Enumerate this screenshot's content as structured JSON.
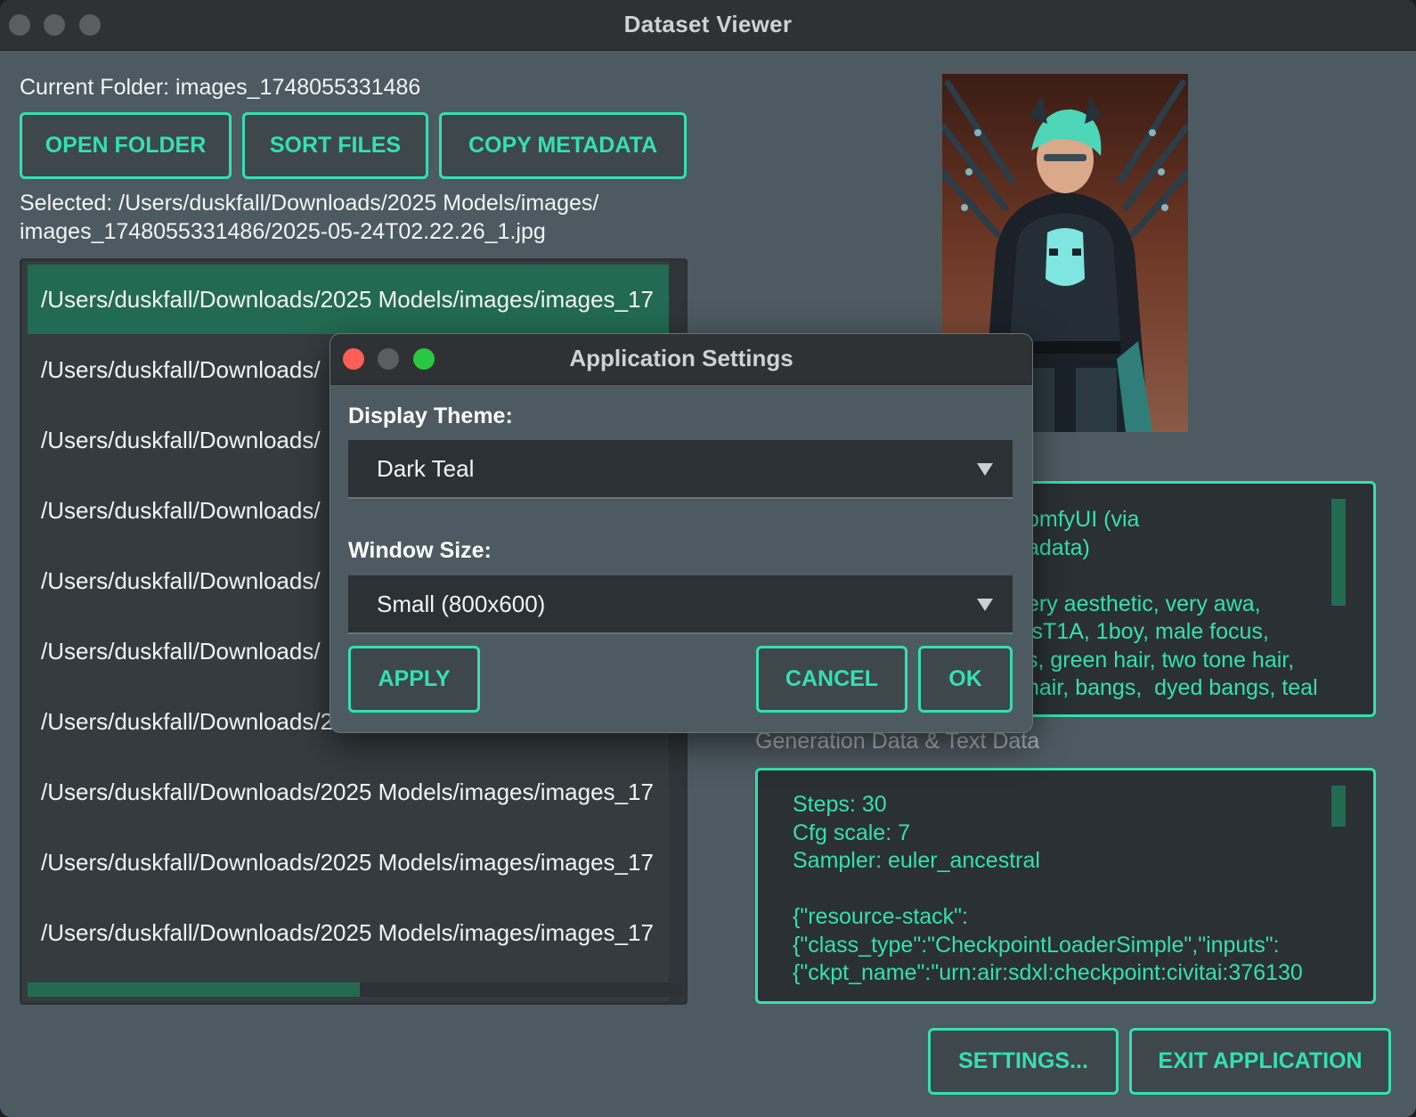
{
  "window": {
    "title": "Dataset Viewer"
  },
  "main": {
    "current_folder": "Current Folder: images_1748055331486",
    "buttons": {
      "open_folder": "OPEN FOLDER",
      "sort_files": "SORT FILES",
      "copy_metadata": "COPY METADATA"
    },
    "selected_line1": "Selected: /Users/duskfall/Downloads/2025 Models/images/",
    "selected_line2": "images_1748055331486/2025-05-24T02.22.26_1.jpg",
    "files": [
      "/Users/duskfall/Downloads/2025 Models/images/images_17",
      "/Users/duskfall/Downloads/",
      "/Users/duskfall/Downloads/",
      "/Users/duskfall/Downloads/",
      "/Users/duskfall/Downloads/",
      "/Users/duskfall/Downloads/",
      "/Users/duskfall/Downloads/2",
      "/Users/duskfall/Downloads/2025 Models/images/images_17",
      "/Users/duskfall/Downloads/2025 Models/images/images_17",
      "/Users/duskfall/Downloads/2025 Models/images/images_17"
    ]
  },
  "metadata": {
    "prompt_lines": [
      "omfyUI (via",
      "adata)",
      "",
      "ery aesthetic, very awa,",
      "isT1A, 1boy, male focus,",
      "s, green hair, two tone hair,",
      "hair, bangs,  dyed bangs, teal"
    ],
    "section_label": "Generation Data & Text Data",
    "generation_lines": [
      "Steps: 30",
      "Cfg scale: 7",
      "Sampler: euler_ancestral",
      "",
      "{\"resource-stack\":",
      "{\"class_type\":\"CheckpointLoaderSimple\",\"inputs\":",
      "{\"ckpt_name\":\"urn:air:sdxl:checkpoint:civitai:376130"
    ]
  },
  "footer": {
    "settings": "SETTINGS...",
    "exit": "EXIT APPLICATION"
  },
  "dialog": {
    "title": "Application Settings",
    "theme_label": "Display Theme:",
    "theme_value": "Dark Teal",
    "size_label": "Window Size:",
    "size_value": "Small (800x600)",
    "apply": "APPLY",
    "cancel": "CANCEL",
    "ok": "OK"
  },
  "colors": {
    "accent": "#34e0b0",
    "selection": "#226b52",
    "background": "#4d5a61",
    "close": "#ff5f57",
    "zoom": "#28c840"
  }
}
